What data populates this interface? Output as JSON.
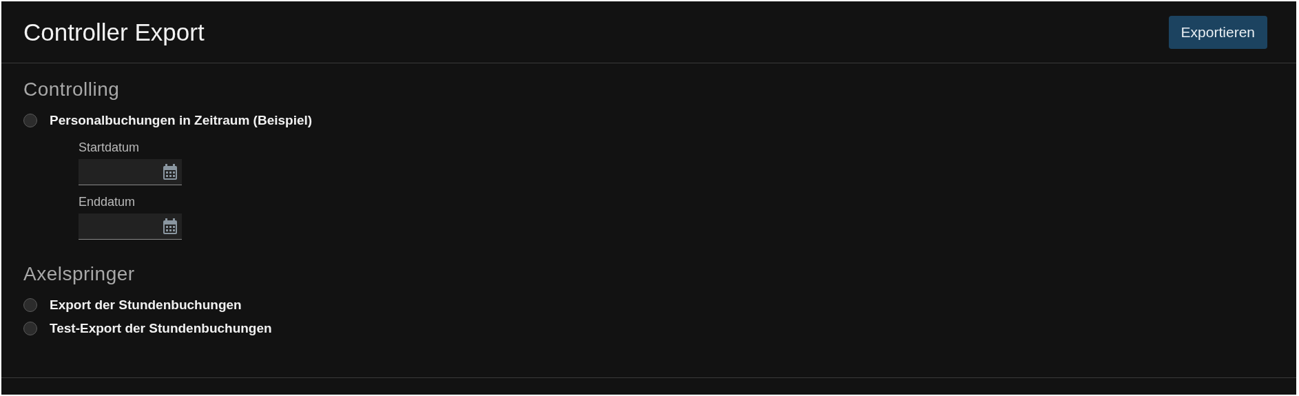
{
  "header": {
    "title": "Controller Export",
    "button": "Exportieren"
  },
  "sections": [
    {
      "title": "Controlling",
      "options": [
        {
          "label": "Personalbuchungen in Zeitraum (Beispiel)",
          "selected": false,
          "fields": [
            {
              "label": "Startdatum"
            },
            {
              "label": "Enddatum"
            }
          ]
        }
      ]
    },
    {
      "title": "Axelspringer",
      "options": [
        {
          "label": "Export der Stundenbuchungen",
          "selected": false
        },
        {
          "label": "Test-Export der Stundenbuchungen",
          "selected": false
        }
      ]
    }
  ]
}
